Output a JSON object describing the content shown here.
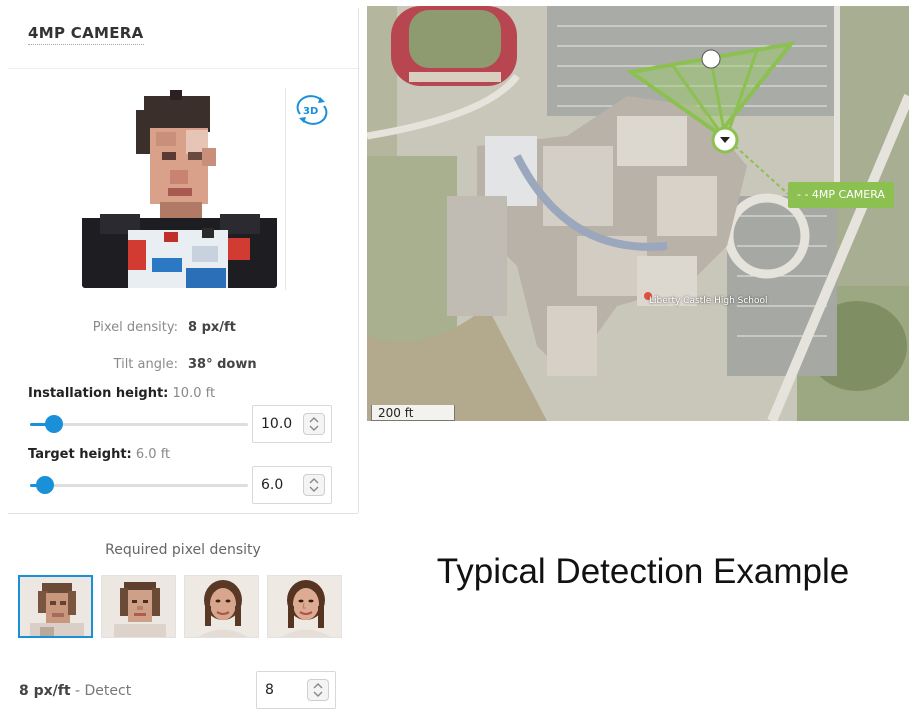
{
  "camera": {
    "title": "4MP CAMERA",
    "view_toggle": "3D"
  },
  "stats": {
    "pixel_density_label": "Pixel density:",
    "pixel_density_value": "8 px/ft",
    "tilt_label": "Tilt angle:",
    "tilt_value": "38° down"
  },
  "installation": {
    "label": "Installation height:",
    "value_text": "10.0 ft",
    "input": "10.0",
    "slider_fraction": 0.11
  },
  "target": {
    "label": "Target height:",
    "value_text": "6.0 ft",
    "input": "6.0",
    "slider_fraction": 0.07
  },
  "required": {
    "title": "Required pixel density",
    "thumbnails": [
      "detect",
      "observe",
      "recognize",
      "identify"
    ],
    "selected_index": 0
  },
  "detect": {
    "value": "8 px/ft",
    "separator": " - ",
    "label": "Detect",
    "input": "8"
  },
  "map": {
    "scale": "200 ft",
    "camera_tag": "- - 4MP CAMERA",
    "place_label": "Liberty Castle High School"
  },
  "caption": "Typical Detection Example",
  "colors": {
    "accent": "#1a90d9",
    "fov_green": "#8cc152"
  }
}
